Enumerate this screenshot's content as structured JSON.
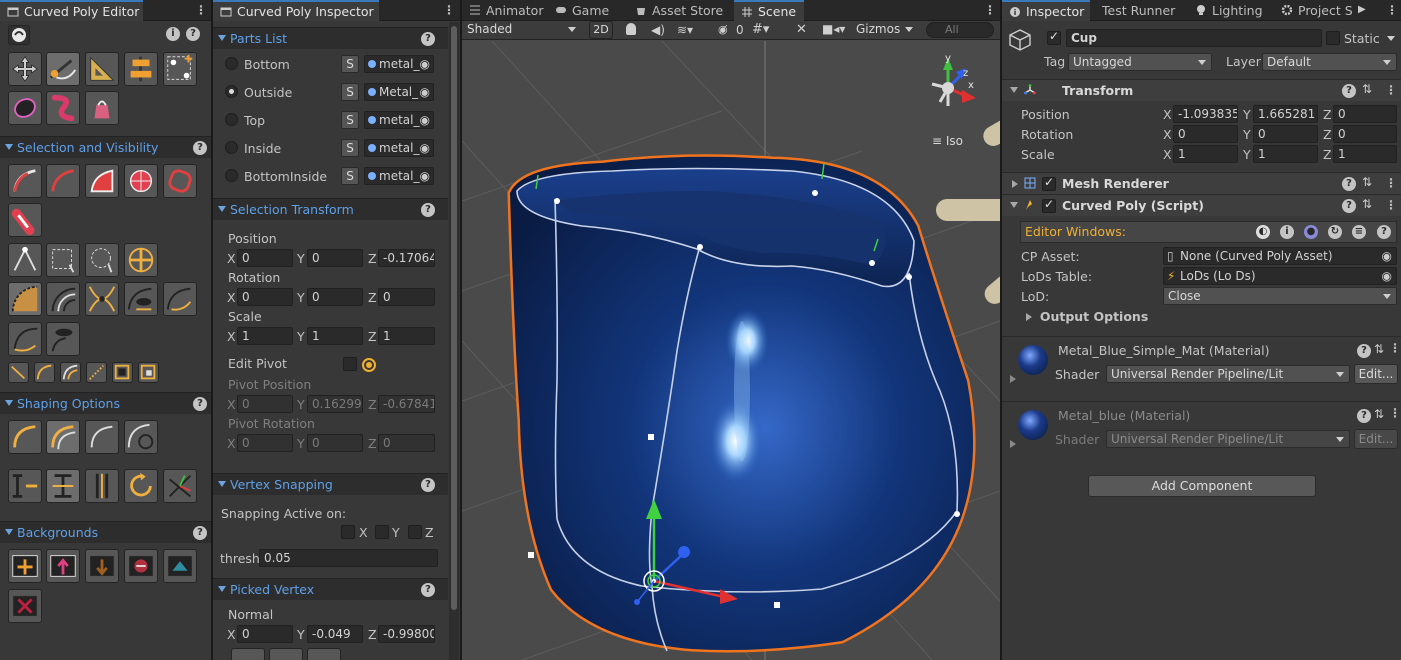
{
  "editor_window": {
    "tab": "Curved Poly Editor",
    "sections": {
      "selection": "Selection and Visibility",
      "shaping": "Shaping Options",
      "backgrounds": "Backgrounds"
    }
  },
  "poly_inspector": {
    "tab": "Curved Poly Inspector",
    "parts_list": {
      "title": "Parts List",
      "parts": [
        {
          "name": "Bottom",
          "material": "metal_"
        },
        {
          "name": "Outside",
          "material": "Metal_"
        },
        {
          "name": "Top",
          "material": "metal_"
        },
        {
          "name": "Inside",
          "material": "metal_"
        },
        {
          "name": "BottomInside",
          "material": "metal_"
        }
      ],
      "selected": 1,
      "s_label": "S"
    },
    "selection_transform": {
      "title": "Selection Transform",
      "position_label": "Position",
      "position": {
        "x": "0",
        "y": "0",
        "z": "-0.17064"
      },
      "rotation_label": "Rotation",
      "rotation": {
        "x": "0",
        "y": "0",
        "z": "0"
      },
      "scale_label": "Scale",
      "scale": {
        "x": "1",
        "y": "1",
        "z": "1"
      },
      "edit_pivot_label": "Edit Pivot",
      "pivot_position_label": "Pivot Position",
      "pivot_position": {
        "x": "0",
        "y": "0.16299",
        "z": "-0.67841"
      },
      "pivot_rotation_label": "Pivot Rotation",
      "pivot_rotation": {
        "x": "0",
        "y": "0",
        "z": "0"
      }
    },
    "vertex_snapping": {
      "title": "Vertex Snapping",
      "active_label": "Snapping Active on:",
      "axes": [
        "X",
        "Y",
        "Z"
      ],
      "thresh_label": "thresh.",
      "thresh_value": "0.05"
    },
    "picked_vertex": {
      "title": "Picked Vertex",
      "normal_label": "Normal",
      "normal": {
        "x": "0",
        "y": "-0.049",
        "z": "-0.99800"
      }
    },
    "axis_labels": {
      "x": "X",
      "y": "Y",
      "z": "Z"
    }
  },
  "scene_view": {
    "tabs": [
      "Animator",
      "Game",
      "Asset Store",
      "Scene"
    ],
    "shading_mode": "Shaded",
    "mode_2d": "2D",
    "hidden_count": "0",
    "gizmos_label": "Gizmos",
    "search_placeholder": "All",
    "projection_label": "Iso",
    "colors": {
      "selection_outline": "#f0741e",
      "background": "#4a4a4a"
    }
  },
  "inspector": {
    "tabs": [
      "Inspector",
      "Test Runner",
      "Lighting",
      "Project S"
    ],
    "object_name": "Cup",
    "static_label": "Static",
    "tag_label": "Tag",
    "tag_value": "Untagged",
    "layer_label": "Layer",
    "layer_value": "Default",
    "transform": {
      "title": "Transform",
      "position_label": "Position",
      "position": {
        "x": "-1.093835",
        "y": "1.665281",
        "z": "0"
      },
      "rotation_label": "Rotation",
      "rotation": {
        "x": "0",
        "y": "0",
        "z": "0"
      },
      "scale_label": "Scale",
      "scale": {
        "x": "1",
        "y": "1",
        "z": "1"
      }
    },
    "mesh_renderer": {
      "title": "Mesh Renderer"
    },
    "curved_poly": {
      "title": "Curved Poly (Script)",
      "editor_windows_label": "Editor Windows:",
      "cp_asset_label": "CP Asset:",
      "cp_asset_value": "None (Curved Poly Asset)",
      "lods_label": "LoDs Table:",
      "lods_value": "LoDs (Lo Ds)",
      "lod_label": "LoD:",
      "lod_value": "Close",
      "output_options": "Output Options"
    },
    "materials": [
      {
        "name": "Metal_Blue_Simple_Mat (Material)",
        "shader_label": "Shader",
        "shader": "Universal Render Pipeline/Lit",
        "edit": "Edit...",
        "dimmed": false
      },
      {
        "name": "Metal_blue (Material)",
        "shader_label": "Shader",
        "shader": "Universal Render Pipeline/Lit",
        "edit": "Edit...",
        "dimmed": true
      }
    ],
    "add_component": "Add Component"
  }
}
